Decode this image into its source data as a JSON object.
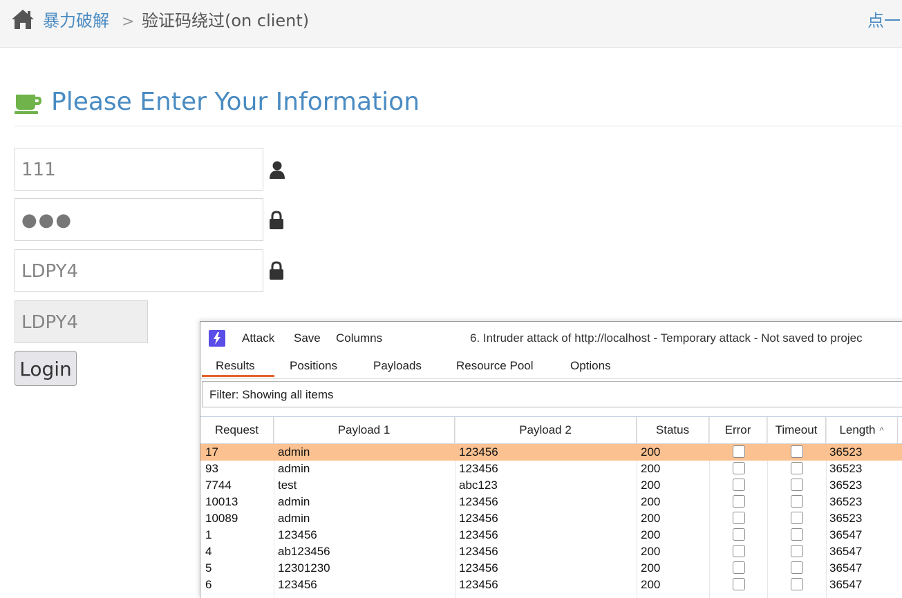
{
  "breadcrumb": {
    "home_icon": "home-icon",
    "link": "暴力破解",
    "separator": ">",
    "current": "验证码绕过(on client)",
    "right_text": "点一"
  },
  "header": {
    "icon": "coffee-cup-icon",
    "title": "Please Enter Your Information"
  },
  "form": {
    "username_value": "111",
    "password_value": "●●●",
    "captcha_input_value": "LDPY4",
    "captcha_display": "LDPY4",
    "login_label": "Login"
  },
  "colors": {
    "accent_blue": "#4a8bc2",
    "cup_green": "#6fb34a",
    "selected_row": "#fbc190",
    "tab_underline": "#e8612c",
    "burp_logo": "#5a4de8"
  },
  "burp": {
    "menu": [
      "Attack",
      "Save",
      "Columns"
    ],
    "title": "6. Intruder attack of http://localhost - Temporary attack - Not saved to projec",
    "tabs": [
      "Results",
      "Positions",
      "Payloads",
      "Resource Pool",
      "Options"
    ],
    "active_tab": "Results",
    "filter": "Filter: Showing all items",
    "columns": [
      "Request",
      "Payload 1",
      "Payload 2",
      "Status",
      "Error",
      "Timeout",
      "Length"
    ],
    "sort_indicator": "^",
    "rows": [
      {
        "request": "17",
        "payload1": "admin",
        "payload2": "123456",
        "status": "200",
        "length": "36523",
        "selected": true
      },
      {
        "request": "93",
        "payload1": "admin",
        "payload2": "123456",
        "status": "200",
        "length": "36523",
        "selected": false
      },
      {
        "request": "7744",
        "payload1": "test",
        "payload2": "abc123",
        "status": "200",
        "length": "36523",
        "selected": false
      },
      {
        "request": "10013",
        "payload1": "admin",
        "payload2": "123456",
        "status": "200",
        "length": "36523",
        "selected": false
      },
      {
        "request": "10089",
        "payload1": "admin",
        "payload2": "123456",
        "status": "200",
        "length": "36523",
        "selected": false
      },
      {
        "request": "1",
        "payload1": "123456",
        "payload2": "123456",
        "status": "200",
        "length": "36547",
        "selected": false
      },
      {
        "request": "4",
        "payload1": "ab123456",
        "payload2": "123456",
        "status": "200",
        "length": "36547",
        "selected": false
      },
      {
        "request": "5",
        "payload1": "12301230",
        "payload2": "123456",
        "status": "200",
        "length": "36547",
        "selected": false
      },
      {
        "request": "6",
        "payload1": "123456",
        "payload2": "123456",
        "status": "200",
        "length": "36547",
        "selected": false
      }
    ]
  }
}
